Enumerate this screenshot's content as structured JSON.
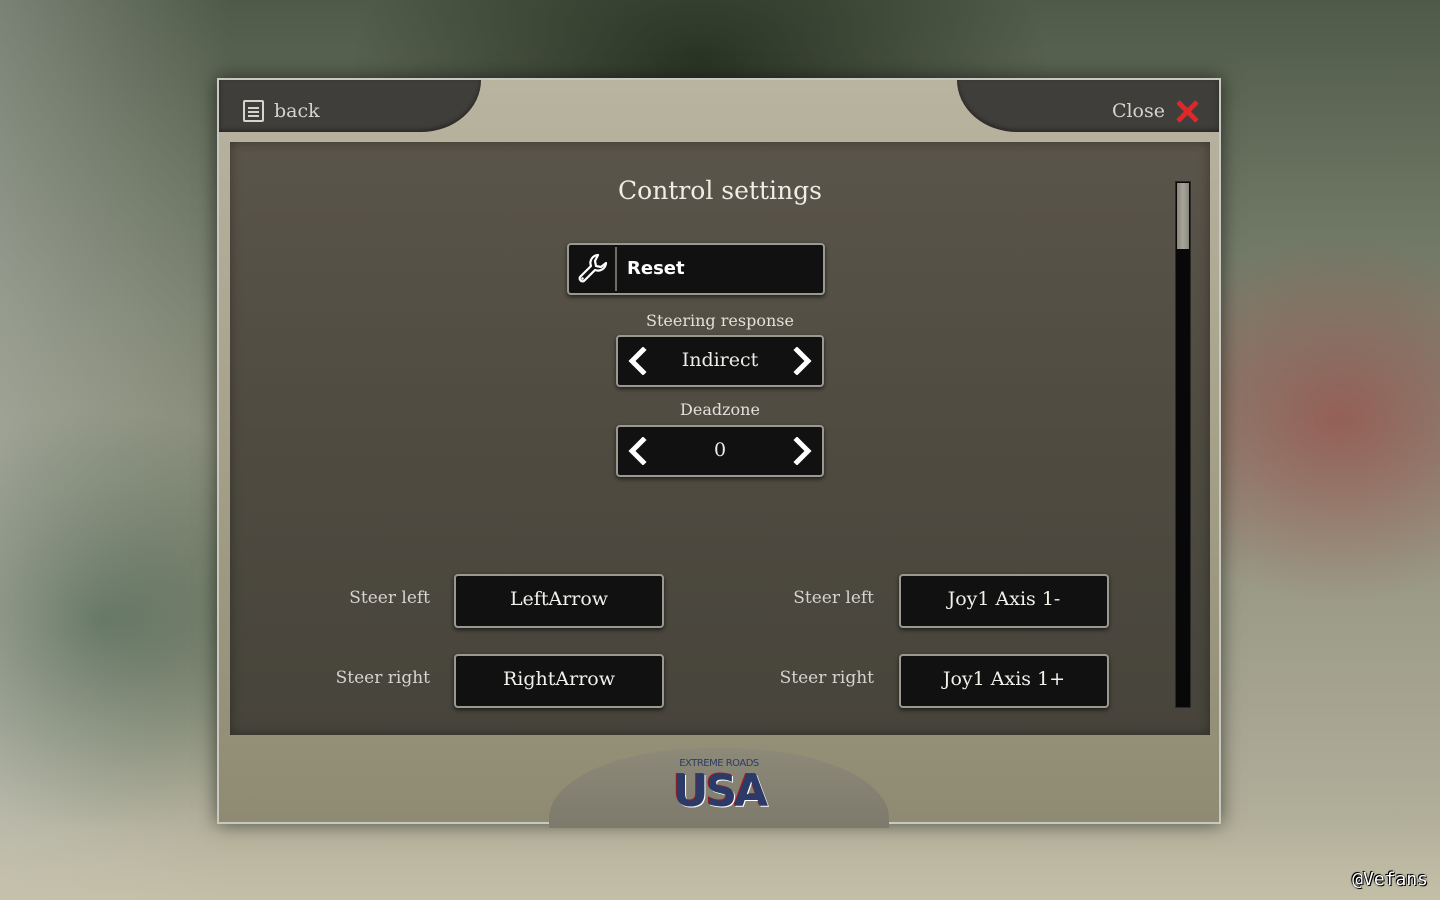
{
  "topbar": {
    "back_label": "back",
    "close_label": "Close"
  },
  "panel": {
    "title": "Control settings",
    "reset_label": "Reset"
  },
  "steering_response": {
    "label": "Steering response",
    "value": "Indirect"
  },
  "deadzone": {
    "label": "Deadzone",
    "value": "0"
  },
  "bindings": {
    "keyboard": [
      {
        "label": "Steer left",
        "key": "LeftArrow"
      },
      {
        "label": "Steer right",
        "key": "RightArrow"
      }
    ],
    "joystick": [
      {
        "label": "Steer left",
        "key": "Joy1 Axis 1-"
      },
      {
        "label": "Steer right",
        "key": "Joy1 Axis 1+"
      }
    ]
  },
  "logo": {
    "small_text": "EXTREME ROADS",
    "big_text": "USA"
  },
  "watermark": "@Vefans",
  "icons": {
    "back": "document-icon",
    "close": "close-x-icon",
    "reset": "wrench-icon",
    "prev": "chevron-left-icon",
    "next": "chevron-right-icon"
  },
  "colors": {
    "close_x": "#e0262a",
    "panel_bg": "#4f4b41",
    "button_bg": "#111111"
  }
}
